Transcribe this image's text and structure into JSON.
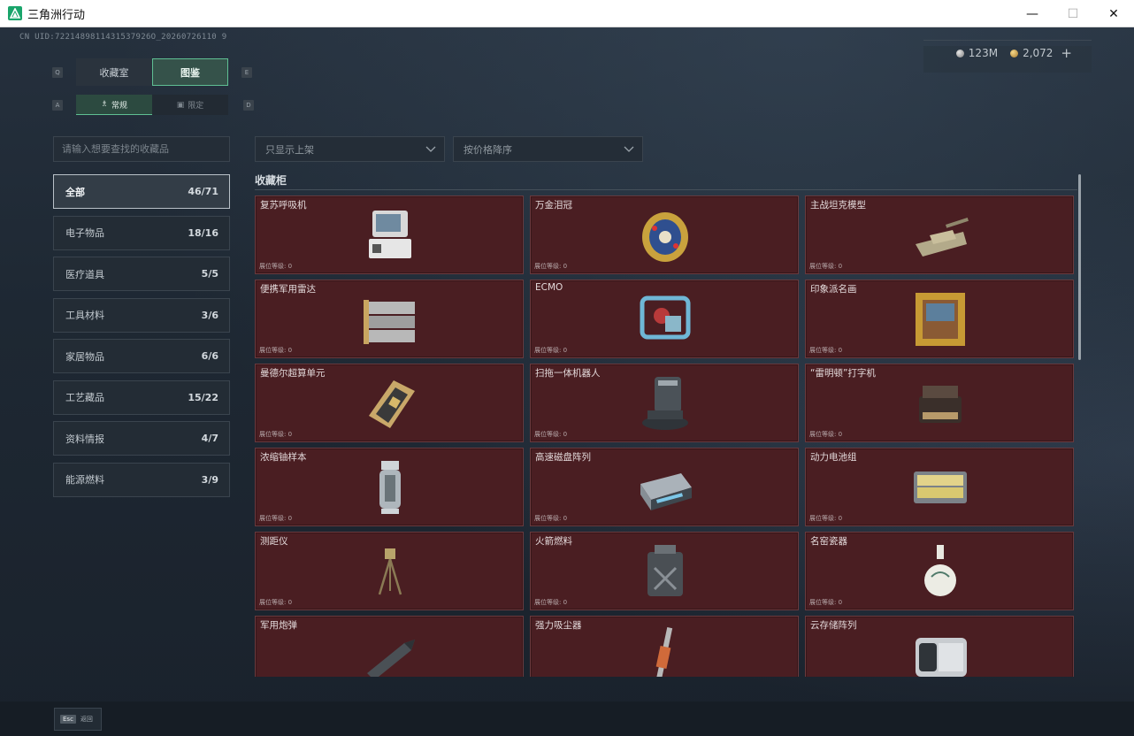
{
  "window": {
    "title": "三角洲行动",
    "minimize": "—",
    "maximize": "☐",
    "close": "✕"
  },
  "uid": "CN UID:7221489811431537926O_20260726110 9",
  "currency": {
    "silver": "123M",
    "gold": "2,072",
    "plus": "+"
  },
  "tabs": {
    "main": [
      {
        "label": "收藏室",
        "key": "Q"
      },
      {
        "label": "图鉴",
        "key": "E"
      }
    ],
    "sub": [
      {
        "label": "常规",
        "key": "A"
      },
      {
        "label": "限定",
        "key": "D"
      }
    ]
  },
  "search": {
    "placeholder": "请输入想要查找的收藏品"
  },
  "filters": {
    "shelf": "只显示上架",
    "sort": "按价格降序"
  },
  "categories": [
    {
      "label": "全部",
      "count": "46/71"
    },
    {
      "label": "电子物品",
      "count": "18/16"
    },
    {
      "label": "医疗道具",
      "count": "5/5"
    },
    {
      "label": "工具材料",
      "count": "3/6"
    },
    {
      "label": "家居物品",
      "count": "6/6"
    },
    {
      "label": "工艺藏品",
      "count": "15/22"
    },
    {
      "label": "资料情报",
      "count": "4/7"
    },
    {
      "label": "能源燃料",
      "count": "3/9"
    }
  ],
  "section": {
    "title": "收藏柜"
  },
  "level_label": "展位等级: 0",
  "items": [
    {
      "name": "复苏呼吸机",
      "icon": "ventilator-icon"
    },
    {
      "name": "万金泪冠",
      "icon": "jeweled-egg-icon"
    },
    {
      "name": "主战坦克模型",
      "icon": "tank-model-icon"
    },
    {
      "name": "便携军用雷达",
      "icon": "radar-icon"
    },
    {
      "name": "ECMO",
      "icon": "ecmo-icon"
    },
    {
      "name": "印象派名画",
      "icon": "painting-icon"
    },
    {
      "name": "曼德尔超算单元",
      "icon": "supercomputer-unit-icon"
    },
    {
      "name": "扫拖一体机器人",
      "icon": "cleaning-robot-icon"
    },
    {
      "name": "“雷明顿”打字机",
      "icon": "typewriter-icon"
    },
    {
      "name": "浓缩铀样本",
      "icon": "uranium-sample-icon"
    },
    {
      "name": "高速磁盘阵列",
      "icon": "disk-array-icon"
    },
    {
      "name": "动力电池组",
      "icon": "battery-pack-icon"
    },
    {
      "name": "测距仪",
      "icon": "rangefinder-icon"
    },
    {
      "name": "火箭燃料",
      "icon": "rocket-fuel-icon"
    },
    {
      "name": "名窑瓷器",
      "icon": "porcelain-vase-icon"
    },
    {
      "name": "军用炮弹",
      "icon": "artillery-shell-icon"
    },
    {
      "name": "强力吸尘器",
      "icon": "vacuum-icon"
    },
    {
      "name": "云存储阵列",
      "icon": "cloud-storage-icon"
    }
  ],
  "bottom": {
    "esc_key": "Esc",
    "back_label": "返回"
  },
  "colors": {
    "accent": "#5fbf93",
    "card_bg": "#4a1e22",
    "panel": "#232c35"
  }
}
